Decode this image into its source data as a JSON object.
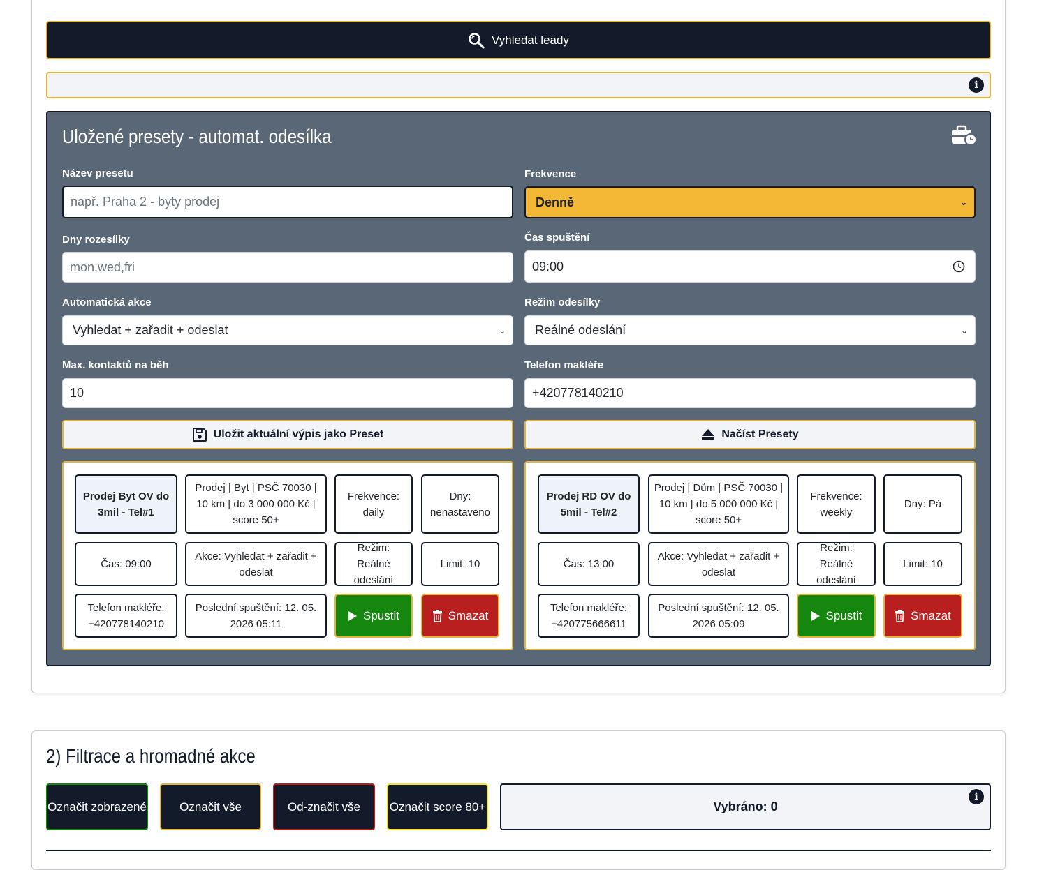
{
  "search": {
    "label": "Vyhledat leady"
  },
  "presets_panel": {
    "title": "Uložené presety - automat. odesílka",
    "fields": {
      "name_label": "Název presetu",
      "name_placeholder": "např. Praha 2 - byty prodej",
      "frequency_label": "Frekvence",
      "frequency_value": "Denně",
      "days_label": "Dny rozesílky",
      "days_placeholder": "mon,wed,fri",
      "time_label": "Čas spuštění",
      "time_value": "09:00",
      "action_label": "Automatická akce",
      "action_value": "Vyhledat + zařadit + odeslat",
      "mode_label": "Režim odesílky",
      "mode_value": "Reálné odeslání",
      "max_label": "Max. kontaktů na běh",
      "max_value": "10",
      "phone_label": "Telefon makléře",
      "phone_value": "+420778140210"
    },
    "save_button": "Uložit aktuální výpis jako Preset",
    "load_button": "Načíst Presety",
    "presets": [
      {
        "name": "Prodej Byt OV do 3mil - Tel#1",
        "description": "Prodej | Byt | PSČ 70030 | 10 km | do 3 000 000 Kč | score 50+",
        "frequency": "Frekvence: daily",
        "days": "Dny: nenastaveno",
        "time": "Čas: 09:00",
        "action": "Akce: Vyhledat + zařadit + odeslat",
        "mode": "Režim: Reálné odeslání",
        "limit": "Limit: 10",
        "phone": "Telefon makléře: +420778140210",
        "last_run": "Poslední spuštění: 12. 05. 2026 05:11",
        "run_label": "Spustit",
        "delete_label": "Smazat"
      },
      {
        "name": "Prodej RD OV do 5mil - Tel#2",
        "description": "Prodej | Dům | PSČ 70030 | 10 km | do 5 000 000 Kč | score 50+",
        "frequency": "Frekvence: weekly",
        "days": "Dny: Pá",
        "time": "Čas: 13:00",
        "action": "Akce: Vyhledat + zařadit + odeslat",
        "mode": "Režim: Reálné odeslání",
        "limit": "Limit: 10",
        "phone": "Telefon makléře: +420775666611",
        "last_run": "Poslední spuštění: 12. 05. 2026 05:09",
        "run_label": "Spustit",
        "delete_label": "Smazat"
      }
    ]
  },
  "section2": {
    "title": "2) Filtrace a hromadné akce",
    "buttons": {
      "mark_visible": "Označit zobrazené",
      "mark_all": "Označit vše",
      "unmark_all": "Od-značit vše",
      "mark_score": "Označit score 80+"
    },
    "selected": "Vybráno: 0"
  },
  "colors": {
    "dark": "#131b2b",
    "accent": "#e5b43a",
    "panel": "#5a6776",
    "run": "#15870e",
    "delete": "#b91f1f",
    "frequency_select": "#f3b835"
  }
}
